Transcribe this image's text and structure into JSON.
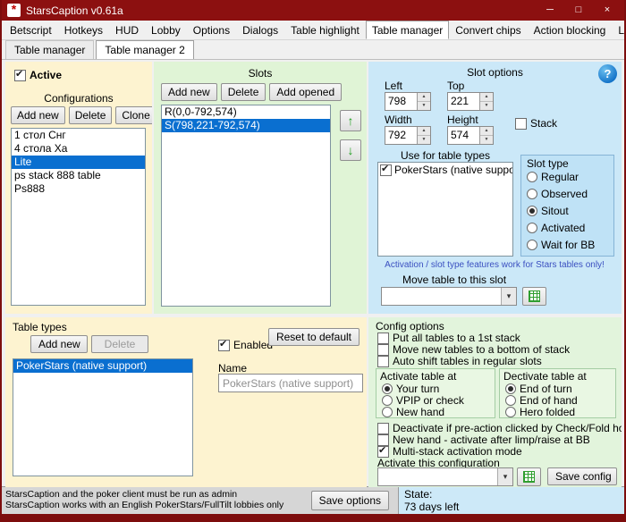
{
  "titlebar": {
    "title": "StarsCaption v0.61a"
  },
  "menubar": {
    "items": [
      "Betscript",
      "Hotkeys",
      "HUD",
      "Lobby",
      "Options",
      "Dialogs",
      "Table highlight",
      "Table manager",
      "Convert chips",
      "Action blocking",
      "License"
    ],
    "active_item": "Table manager"
  },
  "subtabs": {
    "items": [
      "Table manager",
      "Table manager 2"
    ],
    "active_item": "Table manager 2"
  },
  "configurations": {
    "active_label": "Active",
    "active_checked": true,
    "title": "Configurations",
    "buttons": {
      "add_new": "Add new",
      "delete": "Delete",
      "clone": "Clone"
    },
    "list": [
      "1 стол Снг",
      "4 стола Ха",
      "Lite",
      "ps stack 888 table",
      "Ps888"
    ],
    "selected": "Lite"
  },
  "slots": {
    "title": "Slots",
    "buttons": {
      "add_new": "Add new",
      "delete": "Delete",
      "add_opened": "Add opened"
    },
    "list": [
      "R(0,0-792,574)",
      "S(798,221-792,574)"
    ],
    "selected": "S(798,221-792,574)"
  },
  "slot_options": {
    "title": "Slot options",
    "left_label": "Left",
    "left_value": "798",
    "top_label": "Top",
    "top_value": "221",
    "width_label": "Width",
    "width_value": "792",
    "height_label": "Height",
    "height_value": "574",
    "stack_label": "Stack",
    "stack_checked": false,
    "use_for_label": "Use for table types",
    "table_types": [
      {
        "label": "PokerStars (native support",
        "checked": true
      }
    ],
    "slot_type": {
      "title": "Slot type",
      "options": [
        "Regular",
        "Observed",
        "Sitout",
        "Activated",
        "Wait for BB"
      ],
      "selected": "Sitout"
    },
    "note": "Activation / slot type features work for Stars tables only!",
    "move_table_label": "Move table to this slot",
    "move_table_value": ""
  },
  "table_types": {
    "title": "Table types",
    "buttons": {
      "add_new": "Add new",
      "delete": "Delete"
    },
    "delete_disabled": true,
    "list": [
      "PokerStars (native support)"
    ],
    "selected": "PokerStars (native support)",
    "enabled_label": "Enabled",
    "enabled_checked": true,
    "name_label": "Name",
    "name_value": "PokerStars (native support)",
    "reset_button": "Reset to default"
  },
  "config_options": {
    "title": "Config options",
    "checkboxes": [
      {
        "label": "Put all tables to a 1st stack",
        "checked": false
      },
      {
        "label": "Move new tables to a bottom of stack",
        "checked": false
      },
      {
        "label": "Auto shift tables in regular slots",
        "checked": false
      }
    ],
    "activate_group": {
      "title": "Activate table at",
      "options": [
        "Your turn",
        "VPIP or check",
        "New hand"
      ],
      "selected": "Your turn"
    },
    "deactivate_group": {
      "title": "Dectivate table at",
      "options": [
        "End of turn",
        "End of hand",
        "Hero folded"
      ],
      "selected": "End of turn"
    },
    "checkboxes2": [
      {
        "label": "Deactivate if pre-action clicked by Check/Fold hotkey",
        "checked": false
      },
      {
        "label": "New hand - activate after limp/raise at BB",
        "checked": false
      },
      {
        "label": "Multi-stack activation mode",
        "checked": true
      }
    ],
    "activate_config_label": "Activate this configuration",
    "activate_config_value": "",
    "save_config_button": "Save config"
  },
  "statusbar": {
    "line1": "StarsCaption and the poker client must be run as admin",
    "line2": "StarsCaption works with an English PokerStars/FullTilt lobbies only",
    "save_options_button": "Save options",
    "state_label": "State:",
    "state_value": "73 days left"
  },
  "colors": {
    "titlebar": "#8c1010",
    "window_border": "#7d0d0d",
    "panel_yellow": "#fdf3d0",
    "panel_green": "#e0f4d6",
    "panel_blue": "#cbe8f8",
    "selection": "#0a6fd0",
    "state_box": "#cde9f8",
    "note_text": "#3a4fc0",
    "arrow_green": "#1e9e1e"
  }
}
